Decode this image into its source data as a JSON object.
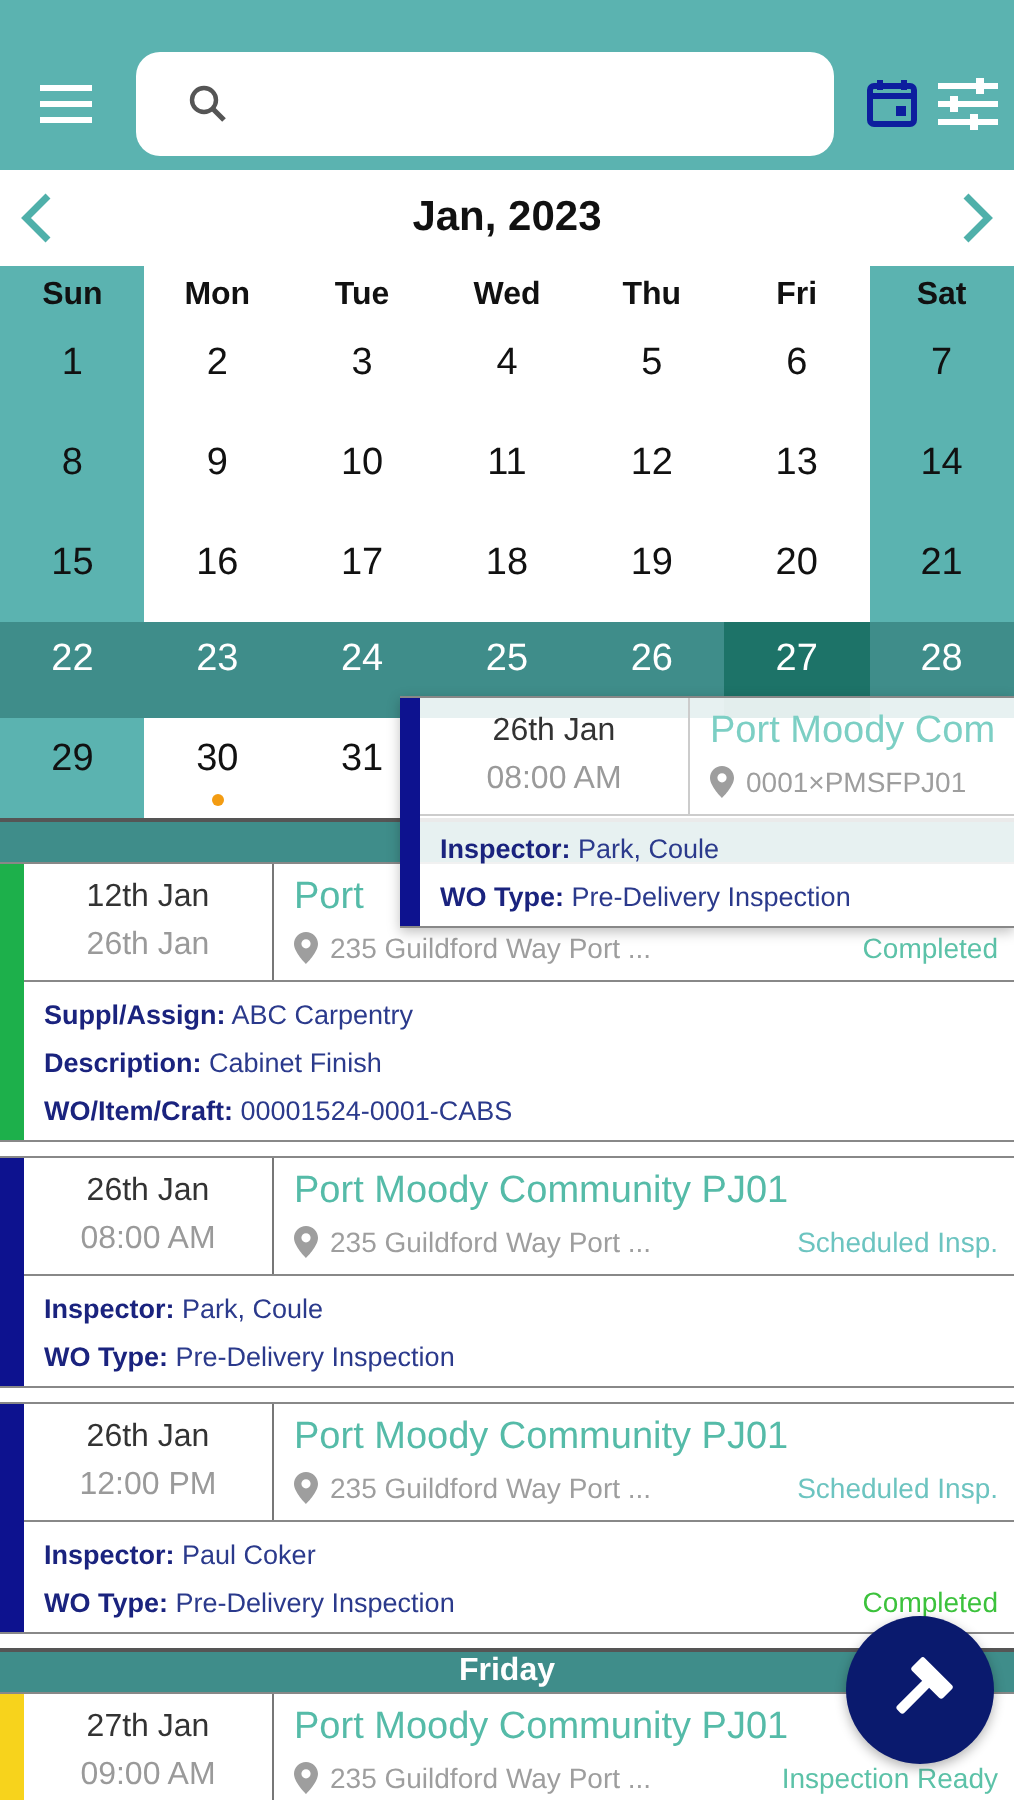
{
  "month_title": "Jan, 2023",
  "weekdays": [
    "Sun",
    "Mon",
    "Tue",
    "Wed",
    "Thu",
    "Fri",
    "Sat"
  ],
  "weeks": [
    {
      "highlighted": false,
      "days": [
        {
          "day": "1",
          "selected": false
        },
        {
          "day": "2",
          "selected": false
        },
        {
          "day": "3",
          "selected": false
        },
        {
          "day": "4",
          "selected": false
        },
        {
          "day": "5",
          "selected": false
        },
        {
          "day": "6",
          "selected": false
        },
        {
          "day": "7",
          "selected": false
        }
      ]
    },
    {
      "highlighted": false,
      "days": [
        {
          "day": "8",
          "selected": false
        },
        {
          "day": "9",
          "selected": false
        },
        {
          "day": "10",
          "selected": false
        },
        {
          "day": "11",
          "selected": false
        },
        {
          "day": "12",
          "selected": false
        },
        {
          "day": "13",
          "selected": false
        },
        {
          "day": "14",
          "selected": false
        }
      ]
    },
    {
      "highlighted": false,
      "days": [
        {
          "day": "15",
          "selected": false
        },
        {
          "day": "16",
          "selected": false
        },
        {
          "day": "17",
          "selected": false
        },
        {
          "day": "18",
          "selected": false
        },
        {
          "day": "19",
          "selected": false
        },
        {
          "day": "20",
          "selected": false
        },
        {
          "day": "21",
          "selected": false
        }
      ]
    },
    {
      "highlighted": true,
      "days": [
        {
          "day": "22",
          "selected": false
        },
        {
          "day": "23",
          "selected": false
        },
        {
          "day": "24",
          "selected": false
        },
        {
          "day": "25",
          "selected": false
        },
        {
          "day": "26",
          "selected": false
        },
        {
          "day": "27",
          "selected": true
        },
        {
          "day": "28",
          "selected": false
        }
      ]
    },
    {
      "highlighted": false,
      "days": [
        {
          "day": "29",
          "selected": false
        },
        {
          "day": "30",
          "selected": false,
          "color": "#f39c12"
        },
        {
          "day": "31",
          "selected": false
        }
      ]
    }
  ],
  "agenda": [
    {
      "cards": [
        {
          "color": "#1db04b",
          "date": "12th Jan",
          "time": "26th Jan",
          "title": "Port",
          "address": "235 Guildford Way Port ...",
          "status": {
            "text": "Completed",
            "color": "#5cc2a8"
          },
          "fields": [
            {
              "label": "Suppl/Assign:",
              "value": "ABC Carpentry"
            },
            {
              "label": "Description:",
              "value": "Cabinet Finish"
            },
            {
              "label": "WO/Item/Craft:",
              "value": "00001524-0001-CABS"
            }
          ]
        },
        {
          "color": "#0d128f",
          "date": "26th Jan",
          "time": "08:00 AM",
          "title": "Port Moody Community PJ01",
          "address": "235 Guildford Way Port ...",
          "status": {
            "text": "Scheduled Insp.",
            "color": "#6cc4c0"
          },
          "fields": [
            {
              "label": "Inspector:",
              "value": "Park, Coule"
            },
            {
              "label": "WO Type:",
              "value": "Pre-Delivery Inspection"
            }
          ]
        },
        {
          "color": "#0d128f",
          "date": "26th Jan",
          "time": "12:00 PM",
          "title": "Port Moody Community PJ01",
          "address": "235 Guildford Way Port ...",
          "status": {
            "text": "Scheduled Insp.",
            "color": "#6cc4c0"
          },
          "fields": [
            {
              "label": "Inspector:",
              "value": "Paul Coker"
            },
            {
              "label": "WO Type:",
              "value": "Pre-Delivery Inspection"
            }
          ],
          "bottom_status": {
            "text": "Completed",
            "color": "#3cc23c"
          }
        }
      ]
    },
    {
      "heading": "Friday",
      "cards": [
        {
          "color": "#f7d31c",
          "date": "27th Jan",
          "time": "09:00 AM",
          "title": "Port Moody Community PJ01",
          "address": "235 Guildford Way Port ...",
          "status": {
            "text": "Inspection Ready",
            "color": "#5cc2a8"
          }
        }
      ]
    }
  ],
  "dragged_card": {
    "color": "#0d128f",
    "date": "26th Jan",
    "time": "08:00 AM",
    "title": "Port Moody Com",
    "address": "0001×PMSFPJ01",
    "fields": [
      {
        "label": "Inspector:",
        "value": "Park, Coule"
      },
      {
        "label": "WO Type:",
        "value": "Pre-Delivery Inspection"
      }
    ]
  }
}
